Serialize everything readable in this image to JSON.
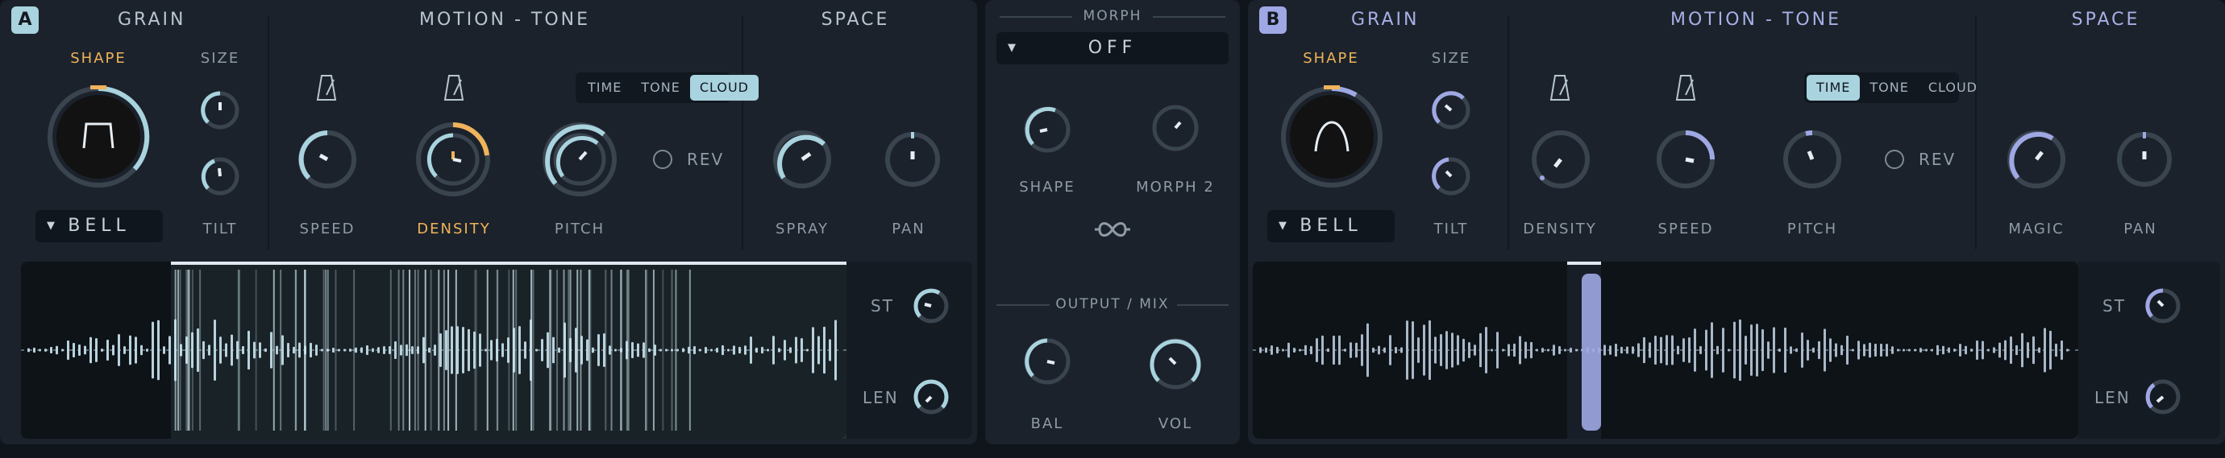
{
  "colors": {
    "accentA": "#a9d3de",
    "accentB": "#9fa8e4",
    "orange": "#f0b35a",
    "panel": "#1b222b",
    "bg": "#0f151b"
  },
  "panelA": {
    "badge": "A",
    "sections": {
      "grain": "GRAIN",
      "motion": "MOTION - TONE",
      "space": "SPACE"
    },
    "shape_label": "SHAPE",
    "size_label": "SIZE",
    "tilt_label": "TILT",
    "shape_dropdown": "BELL",
    "knobs": {
      "k1": "SPEED",
      "k2": "DENSITY",
      "k3": "PITCH",
      "spray": "SPRAY",
      "pan": "PAN"
    },
    "mode_tabs": [
      "TIME",
      "TONE",
      "CLOUD"
    ],
    "active_mode": "CLOUD",
    "rev_label": "REV",
    "st_label": "ST",
    "len_label": "LEN"
  },
  "morph": {
    "title": "MORPH",
    "dropdown": "OFF",
    "shape_label": "SHAPE",
    "morph2_label": "MORPH 2",
    "output_title": "OUTPUT / MIX",
    "bal_label": "BAL",
    "vol_label": "VOL"
  },
  "panelB": {
    "badge": "B",
    "sections": {
      "grain": "GRAIN",
      "motion": "MOTION - TONE",
      "space": "SPACE"
    },
    "shape_label": "SHAPE",
    "size_label": "SIZE",
    "tilt_label": "TILT",
    "shape_dropdown": "BELL",
    "knobs": {
      "k1": "DENSITY",
      "k2": "SPEED",
      "k3": "PITCH",
      "spray": "MAGIC",
      "pan": "PAN"
    },
    "mode_tabs": [
      "TIME",
      "TONE",
      "CLOUD"
    ],
    "active_mode": "TIME",
    "rev_label": "REV",
    "st_label": "ST",
    "len_label": "LEN"
  }
}
